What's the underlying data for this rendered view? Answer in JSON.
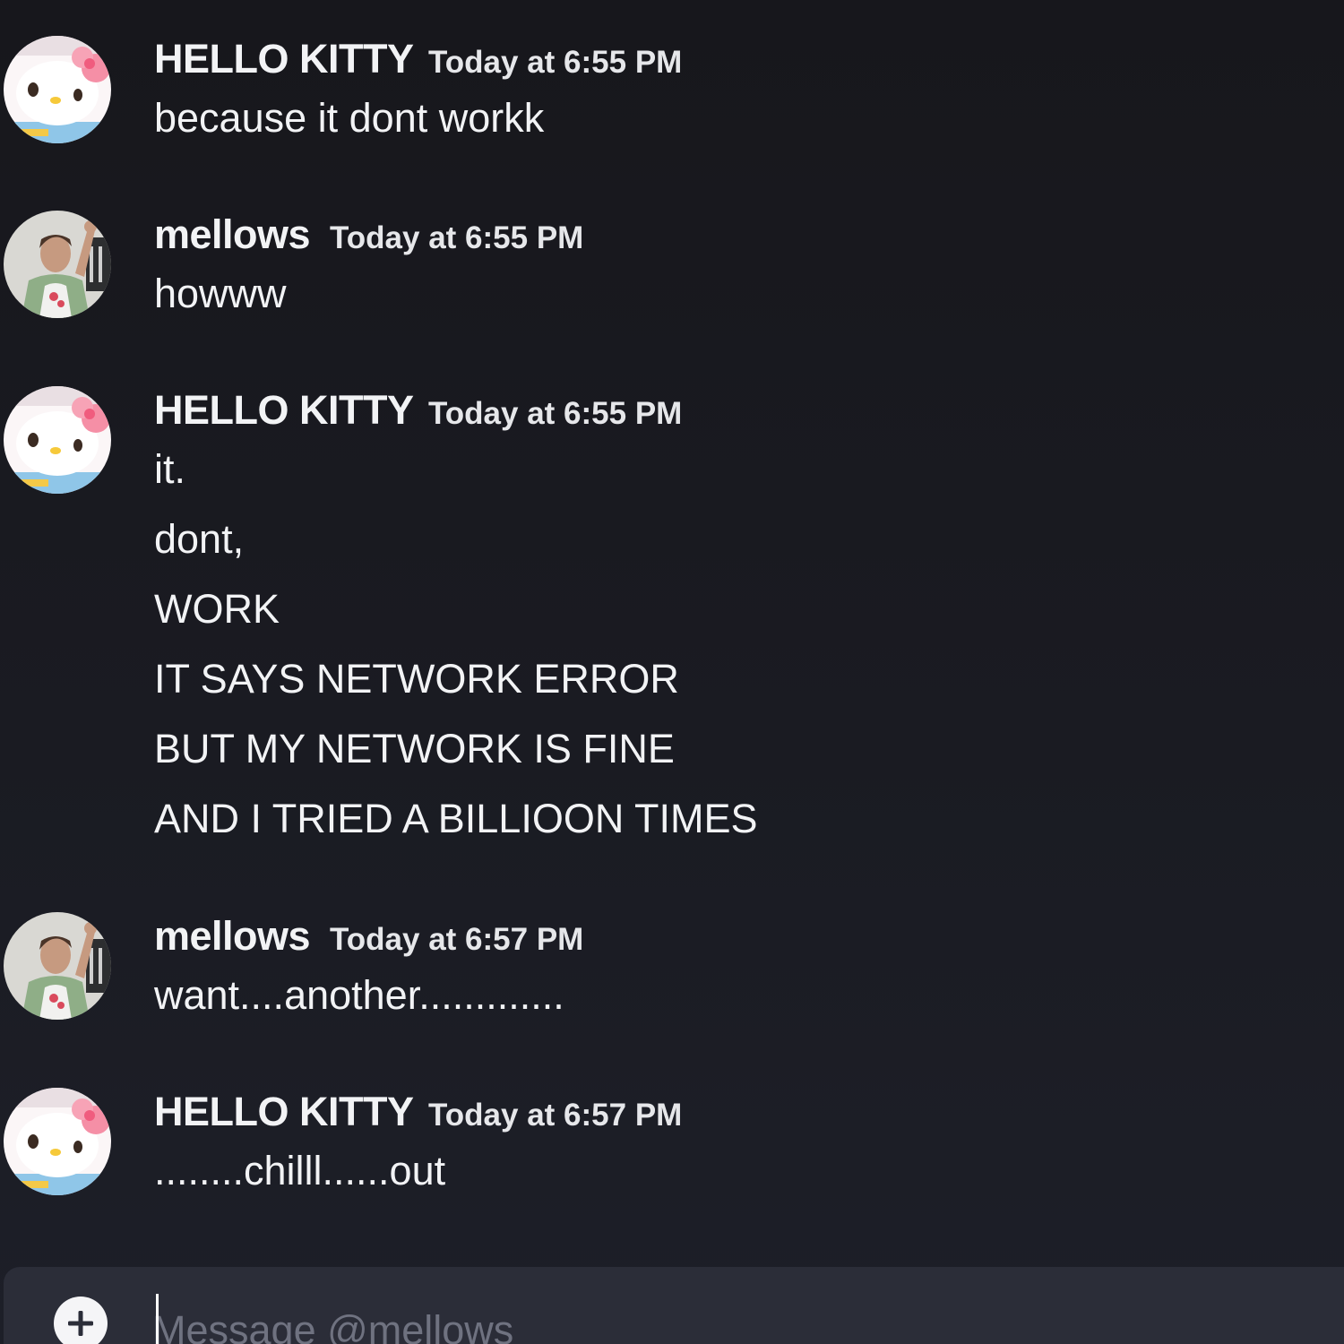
{
  "messages": [
    {
      "author": "HELLO KITTY",
      "timestamp": "Today at 6:55 PM",
      "avatar": "hello-kitty-avatar",
      "lines": [
        "because it dont workk"
      ]
    },
    {
      "author": "mellows",
      "timestamp": "Today at 6:55 PM",
      "avatar": "mellows-avatar",
      "lines": [
        "howww"
      ]
    },
    {
      "author": "HELLO KITTY",
      "timestamp": "Today at 6:55 PM",
      "avatar": "hello-kitty-avatar",
      "lines": [
        "it.",
        "dont,",
        "WORK",
        "IT SAYS NETWORK ERROR",
        "BUT MY NETWORK IS FINE",
        "AND I TRIED A BILLIOON TIMES"
      ]
    },
    {
      "author": "mellows",
      "timestamp": "Today at 6:57 PM",
      "avatar": "mellows-avatar",
      "lines": [
        "want....another............."
      ]
    },
    {
      "author": "HELLO KITTY",
      "timestamp": "Today at 6:57 PM",
      "avatar": "hello-kitty-avatar",
      "lines": [
        "........chilll......out"
      ]
    }
  ],
  "composer": {
    "placeholder": "Message @mellows",
    "attach_icon": "plus-circle-icon"
  },
  "colors": {
    "background": "#1a1b22",
    "composer_background": "#2b2d38",
    "text": "#f2f3f5",
    "placeholder": "#6f7280"
  }
}
